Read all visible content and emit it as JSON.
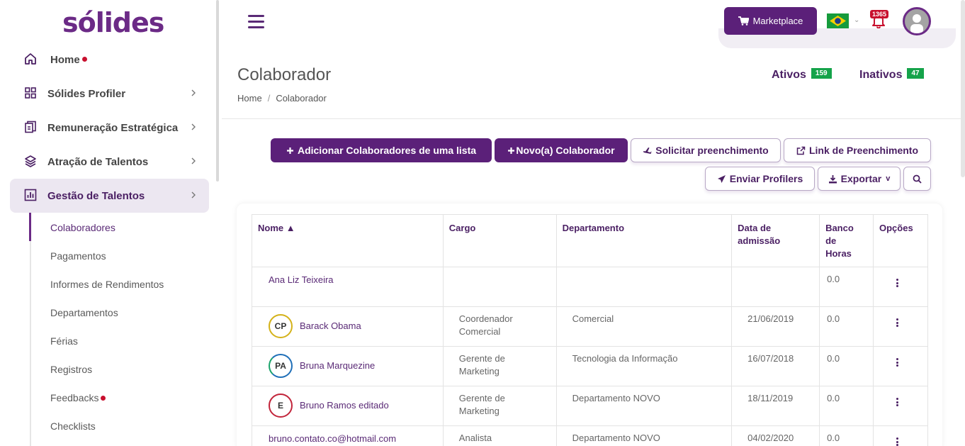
{
  "sidebar": {
    "logo": "sólides",
    "items": [
      {
        "label": "Home",
        "icon": "home-icon"
      },
      {
        "label": "Sólides Profiler",
        "icon": "grid-icon"
      },
      {
        "label": "Remuneração Estratégica",
        "icon": "document-money-icon"
      },
      {
        "label": "Atração de Talentos",
        "icon": "layers-icon"
      },
      {
        "label": "Gestão de Talentos",
        "icon": "chart-icon"
      }
    ],
    "subitems": [
      {
        "label": "Colaboradores"
      },
      {
        "label": "Pagamentos"
      },
      {
        "label": "Informes de Rendimentos"
      },
      {
        "label": "Departamentos"
      },
      {
        "label": "Férias"
      },
      {
        "label": "Registros"
      },
      {
        "label": "Feedbacks"
      },
      {
        "label": "Checklists"
      }
    ]
  },
  "topbar": {
    "marketplace_label": "Marketplace",
    "notification_count": "1365"
  },
  "header": {
    "title": "Colaborador",
    "breadcrumb": [
      "Home",
      "Colaborador"
    ],
    "ativos_label": "Ativos",
    "ativos_count": "159",
    "inativos_label": "Inativos",
    "inativos_count": "47"
  },
  "actions": {
    "add_list": "Adicionar Colaboradores de uma lista",
    "new": "Novo(a) Colaborador",
    "request_fill": "Solicitar preenchimento",
    "fill_link": "Link de Preenchimento",
    "send_profilers": "Enviar Profilers",
    "export": "Exportar"
  },
  "table": {
    "headers": {
      "nome": "Nome ▲",
      "cargo": "Cargo",
      "departamento": "Departamento",
      "admissao_1": "Data de",
      "admissao_2": "admissão",
      "banco_1": "Banco",
      "banco_2": "de",
      "banco_3": "Horas",
      "opcoes": "Opções"
    },
    "rows": [
      {
        "initials": "",
        "name": "Ana Liz Teixeira",
        "cargo_1": "",
        "cargo_2": "",
        "departamento": "",
        "admissao": "",
        "banco": "0.0",
        "ring": ""
      },
      {
        "initials": "CP",
        "name": "Barack Obama",
        "cargo_1": "Coordenador",
        "cargo_2": "Comercial",
        "departamento": "Comercial",
        "admissao": "21/06/2019",
        "banco": "0.0",
        "ring": "#d4b21a"
      },
      {
        "initials": "PA",
        "name": "Bruna Marquezine",
        "cargo_1": "Gerente de",
        "cargo_2": "Marketing",
        "departamento": "Tecnologia da Informação",
        "admissao": "16/07/2018",
        "banco": "0.0",
        "ring": "#1f6fb8"
      },
      {
        "initials": "E",
        "name": "Bruno Ramos editado",
        "cargo_1": "Gerente de",
        "cargo_2": "Marketing",
        "departamento": "Departamento NOVO",
        "admissao": "18/11/2019",
        "banco": "0.0",
        "ring": "#c2253b"
      },
      {
        "initials": "",
        "name": "bruno.contato.co@hotmail.com",
        "cargo_1": "Analista",
        "cargo_2": "",
        "departamento": "Departamento NOVO",
        "admissao": "04/02/2020",
        "banco": "0.0",
        "ring": ""
      }
    ]
  }
}
